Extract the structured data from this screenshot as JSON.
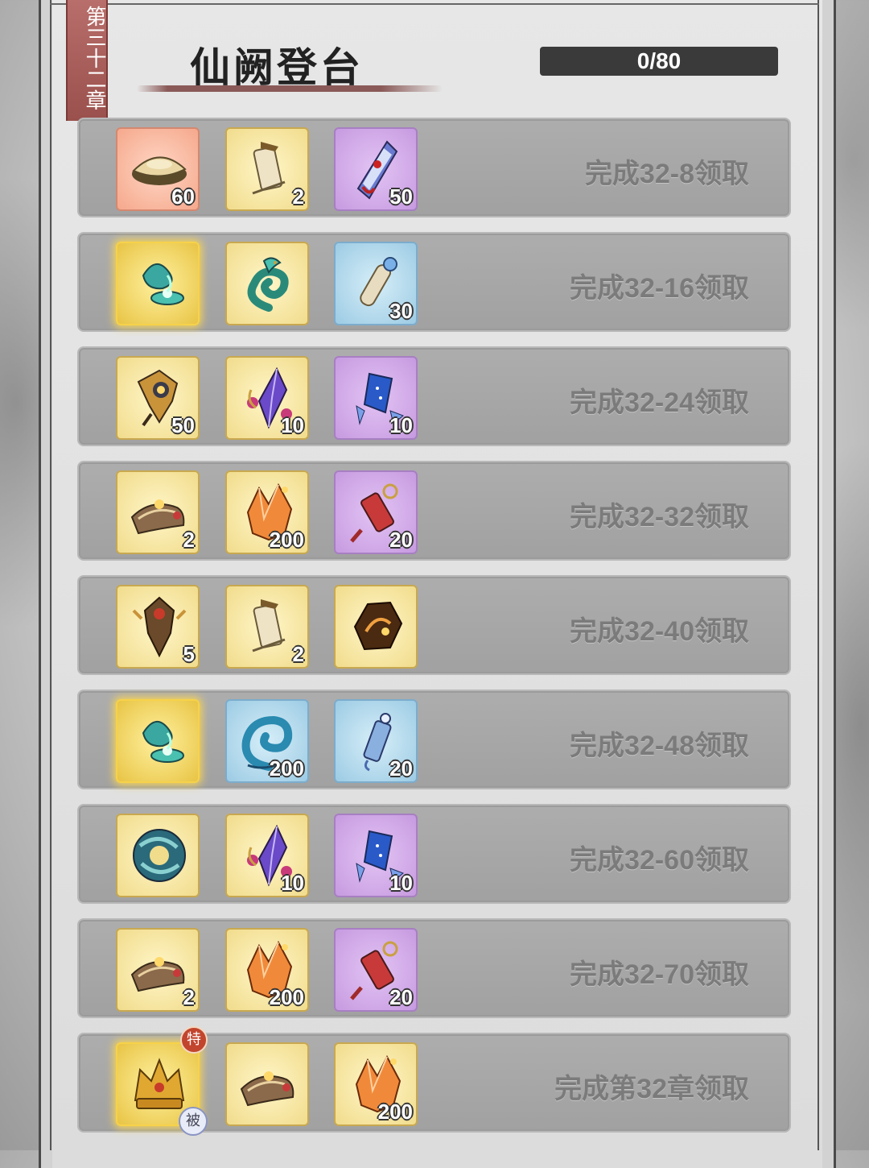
{
  "chapter_label": "第三十二章",
  "title": "仙阙登台",
  "progress": {
    "text": "0/80",
    "value": 0,
    "max": 80
  },
  "rows": [
    {
      "condition": "完成32-8领取",
      "items": [
        {
          "icon": "gold-ingot-icon",
          "quality": "red",
          "qty": "60"
        },
        {
          "icon": "scroll-lantern-icon",
          "quality": "yellow",
          "qty": "2"
        },
        {
          "icon": "purple-talisman-icon",
          "quality": "purple",
          "qty": "50"
        }
      ]
    },
    {
      "condition": "完成32-16领取",
      "items": [
        {
          "icon": "jade-lamp-icon",
          "quality": "gold",
          "qty": ""
        },
        {
          "icon": "jade-dragon-icon",
          "quality": "yellow",
          "qty": ""
        },
        {
          "icon": "bone-scroll-icon",
          "quality": "blue",
          "qty": "30"
        }
      ]
    },
    {
      "condition": "完成32-24领取",
      "items": [
        {
          "icon": "bronze-key-icon",
          "quality": "yellow",
          "qty": "50"
        },
        {
          "icon": "violet-crystal-icon",
          "quality": "yellow",
          "qty": "10"
        },
        {
          "icon": "blue-crystal-icon",
          "quality": "purple",
          "qty": "10"
        }
      ]
    },
    {
      "condition": "完成32-32领取",
      "items": [
        {
          "icon": "incense-scroll-icon",
          "quality": "yellow",
          "qty": "2"
        },
        {
          "icon": "orange-crystal-icon",
          "quality": "yellow",
          "qty": "200"
        },
        {
          "icon": "red-charm-icon",
          "quality": "purple",
          "qty": "20"
        }
      ]
    },
    {
      "condition": "完成32-40领取",
      "items": [
        {
          "icon": "bronze-mask-icon",
          "quality": "yellow",
          "qty": "5"
        },
        {
          "icon": "scroll-lantern-icon",
          "quality": "yellow",
          "qty": "2"
        },
        {
          "icon": "amber-stone-icon",
          "quality": "yellow",
          "qty": ""
        }
      ]
    },
    {
      "condition": "完成32-48领取",
      "items": [
        {
          "icon": "jade-lamp-icon",
          "quality": "gold",
          "qty": ""
        },
        {
          "icon": "wave-swirl-icon",
          "quality": "blue",
          "qty": "200"
        },
        {
          "icon": "blue-charm-icon",
          "quality": "blue",
          "qty": "20"
        }
      ]
    },
    {
      "condition": "完成32-60领取",
      "items": [
        {
          "icon": "jade-ring-icon",
          "quality": "yellow",
          "qty": ""
        },
        {
          "icon": "violet-crystal-icon",
          "quality": "yellow",
          "qty": "10"
        },
        {
          "icon": "blue-crystal-icon",
          "quality": "purple",
          "qty": "10"
        }
      ]
    },
    {
      "condition": "完成32-70领取",
      "items": [
        {
          "icon": "incense-scroll-icon",
          "quality": "yellow",
          "qty": "2"
        },
        {
          "icon": "orange-crystal-icon",
          "quality": "yellow",
          "qty": "200"
        },
        {
          "icon": "red-charm-icon",
          "quality": "purple",
          "qty": "20"
        }
      ]
    },
    {
      "condition": "完成第32章领取",
      "items": [
        {
          "icon": "golden-crown-icon",
          "quality": "gold",
          "qty": "",
          "badge_top": "特",
          "badge_bottom": "被"
        },
        {
          "icon": "incense-scroll-icon",
          "quality": "yellow",
          "qty": ""
        },
        {
          "icon": "orange-crystal-icon",
          "quality": "yellow",
          "qty": "200"
        }
      ]
    }
  ],
  "colors": {
    "yellow": "#f1dc8c",
    "purple": "#c79ae0",
    "blue": "#9ccbe4",
    "red": "#f5a88c",
    "gold": "#e8c444"
  }
}
